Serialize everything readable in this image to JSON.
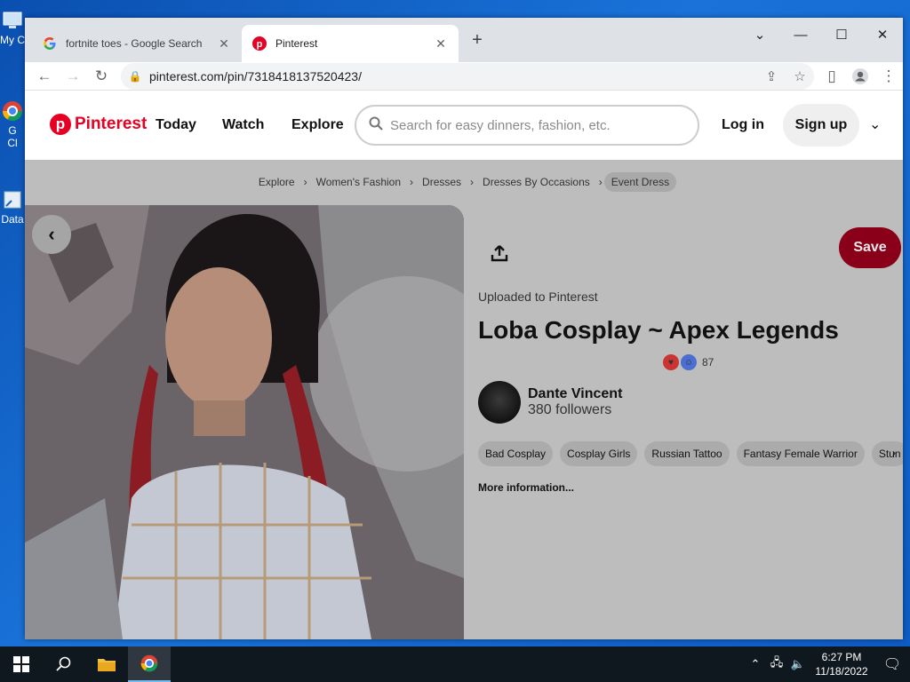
{
  "desktop": {
    "icons": [
      {
        "label": "My C",
        "name": "my-computer"
      },
      {
        "label": "G",
        "sub": "Cl",
        "name": "google-chrome"
      },
      {
        "label": "Data",
        "name": "data-shortcut"
      }
    ]
  },
  "browser": {
    "tabs": [
      {
        "title": "fortnite toes - Google Search",
        "favicon": "google-icon",
        "active": false
      },
      {
        "title": "Pinterest",
        "favicon": "pinterest-icon",
        "active": true
      }
    ],
    "url": "pinterest.com/pin/7318418137520423/"
  },
  "pinterest": {
    "brand": "Pinterest",
    "nav": [
      "Today",
      "Watch",
      "Explore"
    ],
    "search_placeholder": "Search for easy dinners, fashion, etc.",
    "login_label": "Log in",
    "signup_label": "Sign up",
    "breadcrumbs": [
      "Explore",
      "Women's Fashion",
      "Dresses",
      "Dresses By Occasions",
      "Event Dress"
    ],
    "pin": {
      "save_label": "Save",
      "uploaded": "Uploaded to Pinterest",
      "title": "Loba Cosplay ~ Apex Legends",
      "reaction_count": "87",
      "author_name": "Dante Vincent",
      "author_followers": "380 followers",
      "tags": [
        "Bad Cosplay",
        "Cosplay Girls",
        "Russian Tattoo",
        "Fantasy Female Warrior",
        "Stun"
      ],
      "more_info": "More information..."
    }
  },
  "taskbar": {
    "time": "6:27 PM",
    "date": "11/18/2022"
  },
  "colors": {
    "pinterest_red": "#e60023",
    "save_dimmed": "#8a0018",
    "overlay": "#bdbdbd",
    "taskbar": "#10181f"
  }
}
